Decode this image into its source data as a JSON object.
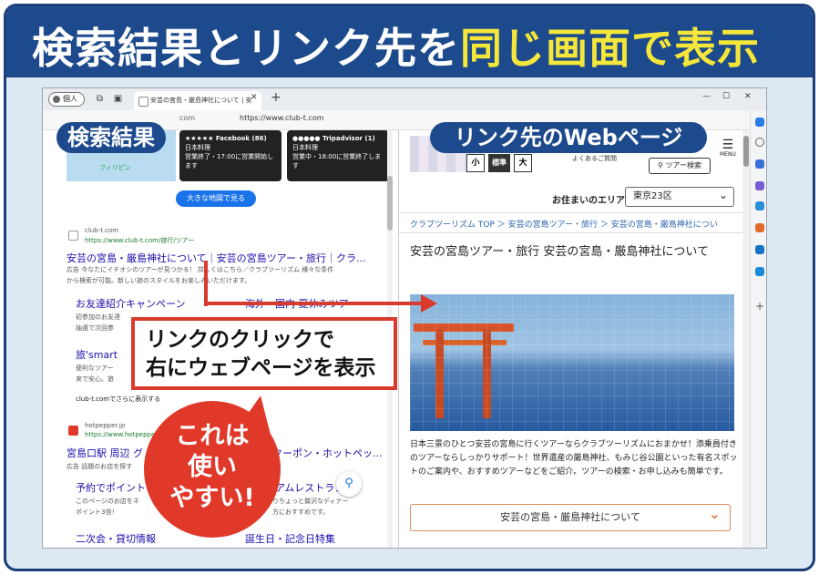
{
  "banner": {
    "title_main": "検索結果とリンク先を",
    "title_highlight": "同じ画面で表示"
  },
  "browser": {
    "profile": "個人",
    "tab_title": "安芸の宮島・厳島神社について | 安",
    "url": "https://www.club-t.com",
    "url_left": "com"
  },
  "left_pane": {
    "label": "検索結果",
    "map_place": "フィリピン",
    "card1": {
      "rating": "★★★★★ Facebook (86)",
      "type": "日本料理",
      "hours": "営業終了・17:00に営業開始します"
    },
    "card2": {
      "rating": "●●●●● Tripadvisor (1)",
      "type": "日本料理",
      "hours": "営業中・18:00に営業終了します"
    },
    "big_map_button": "大きな地図で見る",
    "result1": {
      "site": "club-t.com",
      "url": "https://www.club-t.com/旅行/ツアー",
      "title": "安芸の宮島・厳島神社について｜安芸の宮島ツアー・旅行｜クラ...",
      "snippet1": "広告 今なたにイチオシのツアーが見つかる！ 詳しくはこちら／クラブツーリズム 様々な条件",
      "snippet2": "から検索が可能。新しい旅のスタイルをお楽しみいただけます。",
      "sub1_title": "お友達紹介キャンペーン",
      "sub1_desc1": "初参加のお友達",
      "sub1_desc2": "抽選で次回参",
      "sub2_title": "海外・国内 夏休みツアー",
      "sub3_title": "旅'smart",
      "sub3_desc1": "便利なツアー",
      "sub3_desc2": "来で安心。旅",
      "more": "club-t.comでさらに表示する"
    },
    "result2": {
      "site": "hotpepper.jp",
      "url": "https://www.hotpepper.jp",
      "title_a": "宮島口駅 周辺 グ",
      "title_b": "クーポン・ホットペッ...",
      "snippet": "広告 話題のお店を探す",
      "sub1_title": "予約でポイント",
      "sub1_desc1": "このページのお店をネ",
      "sub1_desc2": "ポイント3倍！",
      "sub2_title": "プレミアムレストラン",
      "sub2_desc1": "りちょっと贅沢なディナー",
      "sub2_desc2": "方におすすめです。",
      "sub3_title": "二次会・貸切情報",
      "sub4_title": "誕生日・記念日特集"
    }
  },
  "right_pane": {
    "label": "リンク先のWebページ",
    "size_small": "小",
    "size_normal": "標準",
    "size_large": "大",
    "faq": "よくあるご質問",
    "tour_search": "ツアー検索",
    "menu": "MENU",
    "area_label": "お住まいのエリア",
    "area_value": "東京23区",
    "breadcrumb": "クラブツーリズム TOP ＞ 安芸の宮島ツアー・旅行 ＞ 安芸の宮島・厳島神社につい",
    "title": "安芸の宮島ツアー・旅行 安芸の宮島・厳島神社について",
    "desc": "日本三景のひとつ安芸の宮島に行くツアーならクラブツーリズムにおまかせ！添乗員付きのツアーならしっかりサポート！世界遺産の厳島神社、もみじ谷公園といった有名スポットのご案内や、おすすめツアーなどをご紹介。ツアーの検索・お申し込みも簡単です。",
    "accordion": "安芸の宮島・厳島神社について"
  },
  "callout": {
    "line1": "リンクのクリックで",
    "line2": "右にウェブページを表示"
  },
  "burst": {
    "line1": "これは",
    "line2": "使い",
    "line3": "やすい!"
  },
  "colors": {
    "navy": "#1d4a8c",
    "red": "#d83a2e",
    "yellow": "#f5e63a"
  }
}
